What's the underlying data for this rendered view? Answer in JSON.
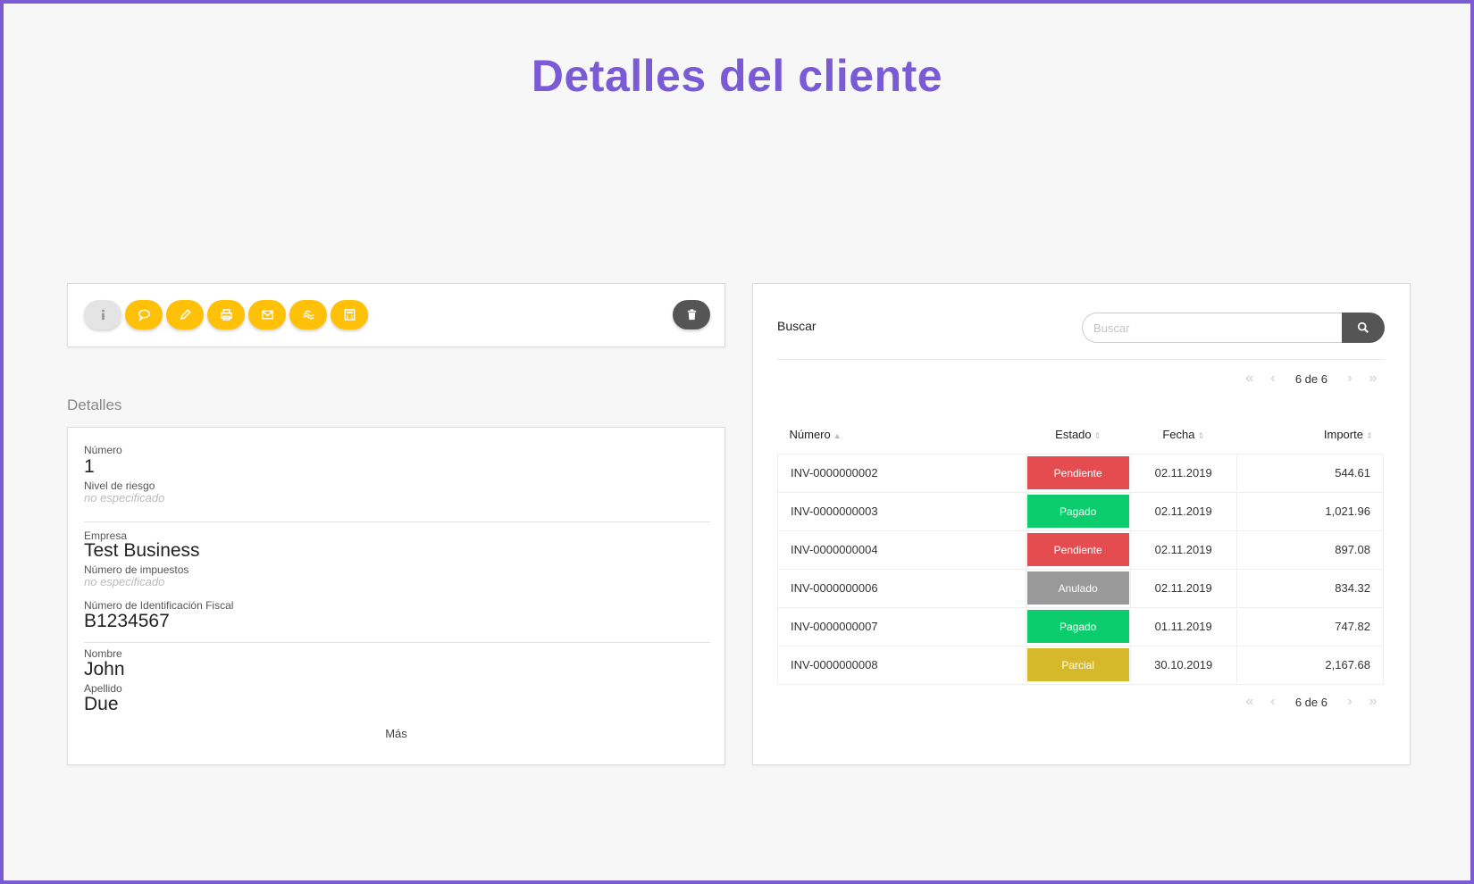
{
  "page": {
    "title": "Detalles del cliente"
  },
  "toolbar": {
    "buttons": [
      {
        "icon": "info-icon",
        "style": "grey"
      },
      {
        "icon": "comment-icon",
        "style": "yellow"
      },
      {
        "icon": "pencil-icon",
        "style": "yellow"
      },
      {
        "icon": "print-icon",
        "style": "yellow"
      },
      {
        "icon": "envelope-icon",
        "style": "yellow"
      },
      {
        "icon": "money-icon",
        "style": "yellow"
      },
      {
        "icon": "calculator-icon",
        "style": "yellow"
      }
    ],
    "delete_icon": "trash-icon"
  },
  "details": {
    "section_label": "Detalles",
    "numero_label": "Número",
    "numero_value": "1",
    "riesgo_label": "Nivel de riesgo",
    "riesgo_value": "no especificado",
    "empresa_label": "Empresa",
    "empresa_value": "Test Business",
    "impuestos_label": "Número de impuestos",
    "impuestos_value": "no especificado",
    "nif_label": "Número de Identificación Fiscal",
    "nif_value": "B1234567",
    "nombre_label": "Nombre",
    "nombre_value": "John",
    "apellido_label": "Apellido",
    "apellido_value": "Due",
    "more_label": "Más"
  },
  "invoices": {
    "search_label": "Buscar",
    "search_placeholder": "Buscar",
    "search_value": "",
    "pager_text": "6 de 6",
    "columns": {
      "numero": "Número",
      "estado": "Estado",
      "fecha": "Fecha",
      "importe": "Importe"
    },
    "rows": [
      {
        "numero": "INV-0000000002",
        "estado": "Pendiente",
        "fecha": "02.11.2019",
        "importe": "544.61"
      },
      {
        "numero": "INV-0000000003",
        "estado": "Pagado",
        "fecha": "02.11.2019",
        "importe": "1,021.96"
      },
      {
        "numero": "INV-0000000004",
        "estado": "Pendiente",
        "fecha": "02.11.2019",
        "importe": "897.08"
      },
      {
        "numero": "INV-0000000006",
        "estado": "Anulado",
        "fecha": "02.11.2019",
        "importe": "834.32"
      },
      {
        "numero": "INV-0000000007",
        "estado": "Pagado",
        "fecha": "01.11.2019",
        "importe": "747.82"
      },
      {
        "numero": "INV-0000000008",
        "estado": "Parcial",
        "fecha": "30.10.2019",
        "importe": "2,167.68"
      }
    ],
    "status_colors": {
      "Pendiente": "#e44c4f",
      "Pagado": "#0ccd6e",
      "Anulado": "#999999",
      "Parcial": "#d6b92b"
    }
  },
  "colors": {
    "accent": "#7b5ad6",
    "action_yellow": "#ffc107",
    "dark_button": "#555555"
  }
}
